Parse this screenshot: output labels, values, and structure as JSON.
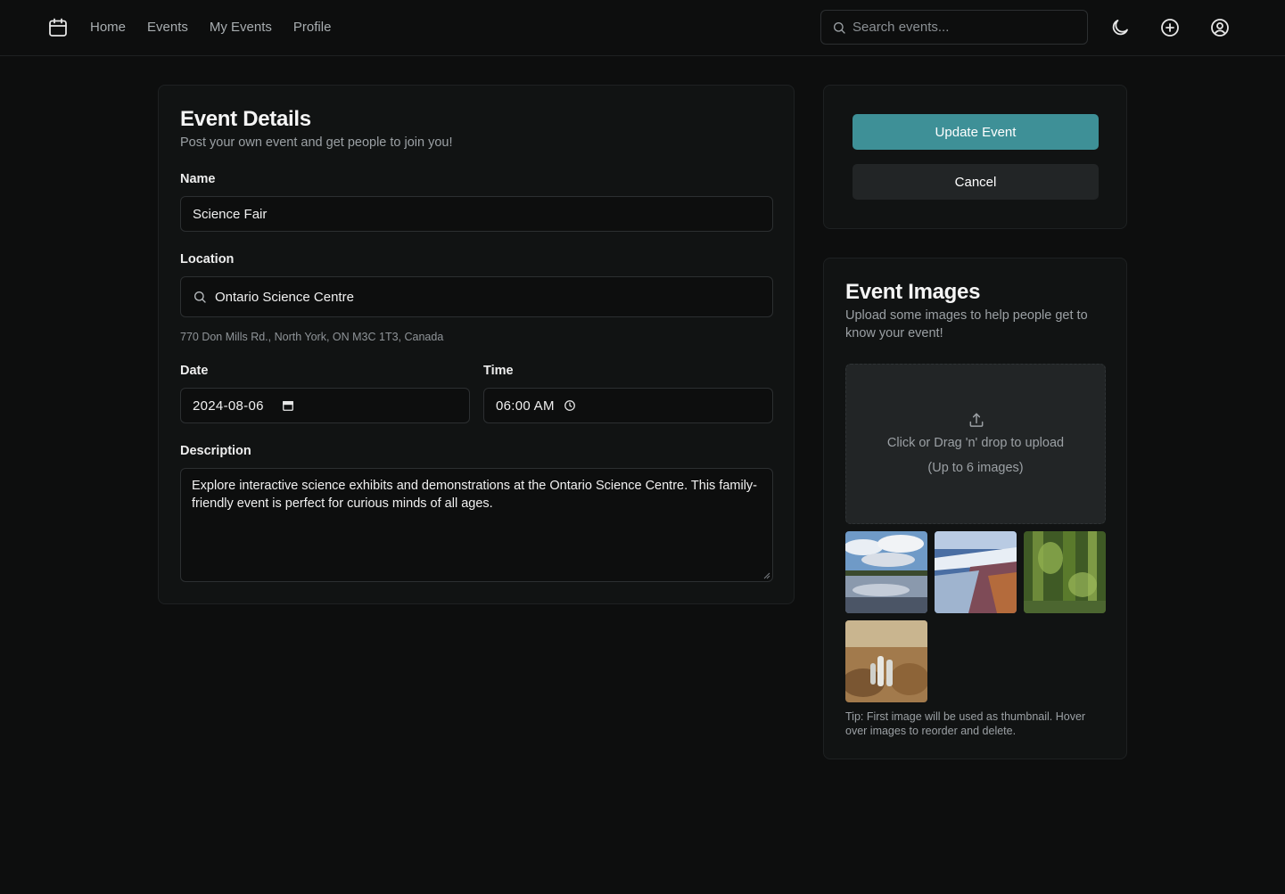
{
  "nav": {
    "items": [
      "Home",
      "Events",
      "My Events",
      "Profile"
    ],
    "search_placeholder": "Search events..."
  },
  "details": {
    "title": "Event Details",
    "subtitle": "Post your own event and get people to join you!",
    "name_label": "Name",
    "name_value": "Science Fair",
    "location_label": "Location",
    "location_value": "Ontario Science Centre",
    "address": "770 Don Mills Rd., North York, ON M3C 1T3, Canada",
    "date_label": "Date",
    "date_value": "2024-08-06",
    "time_label": "Time",
    "time_value": "06:00 AM",
    "description_label": "Description",
    "description_value": "Explore interactive science exhibits and demonstrations at the Ontario Science Centre. This family-friendly event is perfect for curious minds of all ages."
  },
  "actions": {
    "update_label": "Update Event",
    "cancel_label": "Cancel"
  },
  "images": {
    "title": "Event Images",
    "subtitle": "Upload some images to help people get to know your event!",
    "drop_line1": "Click or Drag 'n' drop to upload",
    "drop_line2": "(Up to 6 images)",
    "tip": "Tip: First image will be used as thumbnail. Hover over images to reorder and delete."
  },
  "colors": {
    "accent": "#3e9097",
    "background": "#0d0e0e",
    "card": "#111313"
  },
  "icons": [
    "calendar-icon",
    "search-icon",
    "moon-icon",
    "plus-circle-icon",
    "user-circle-icon",
    "upload-icon",
    "clock-icon"
  ]
}
